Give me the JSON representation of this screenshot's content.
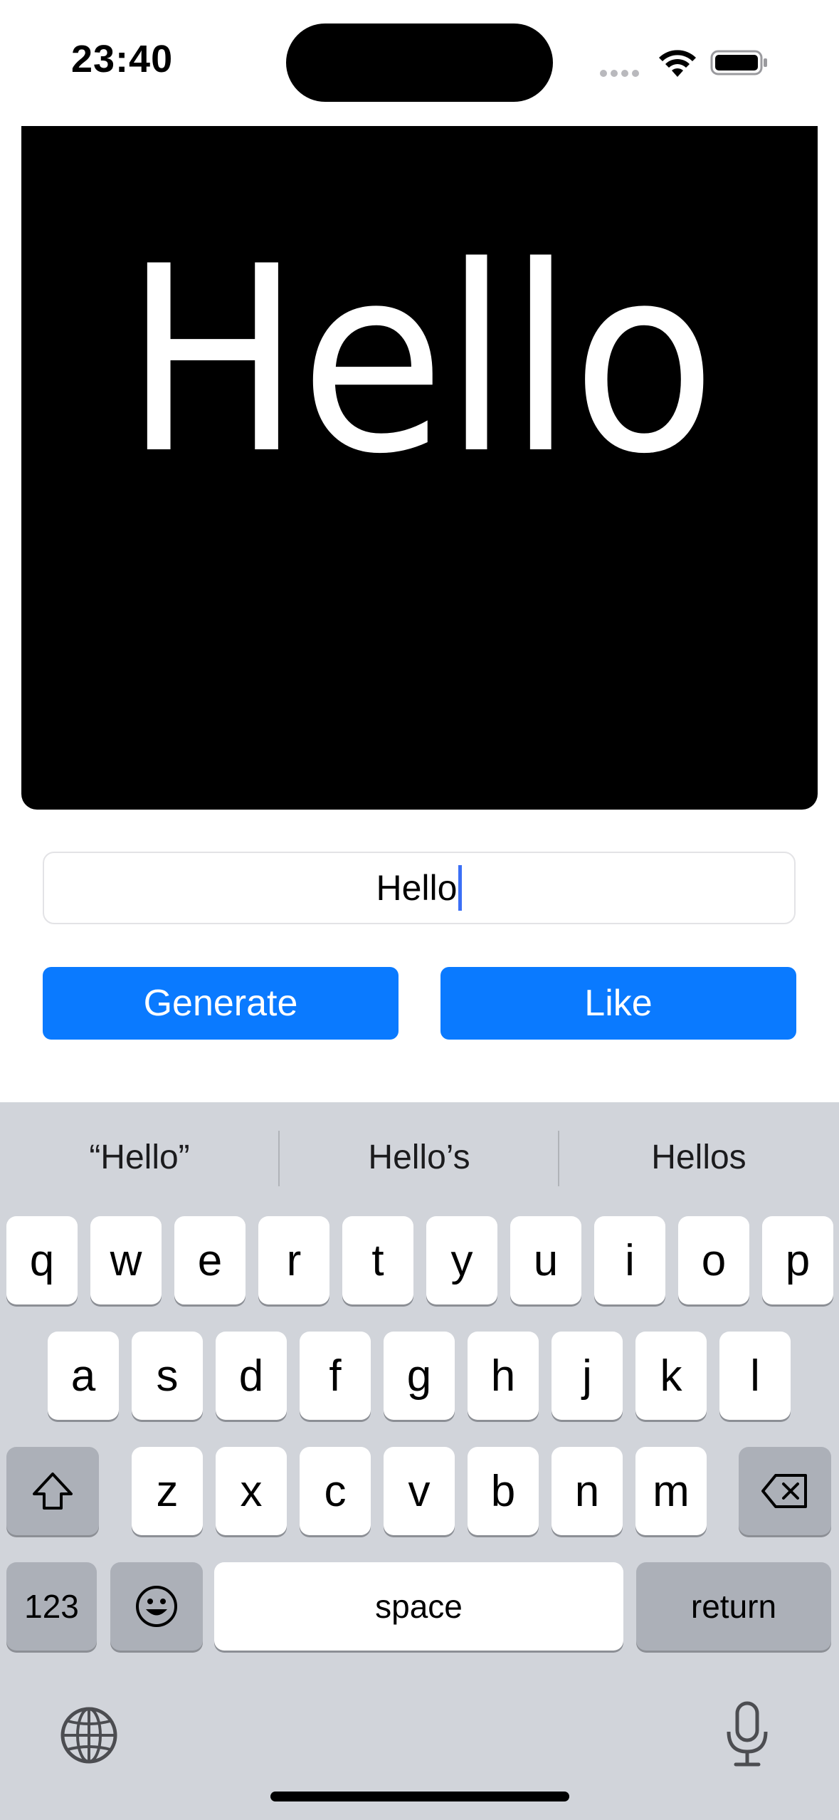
{
  "status_bar": {
    "time": "23:40"
  },
  "preview": {
    "text": "Hello"
  },
  "text_field": {
    "value": "Hello"
  },
  "buttons": {
    "generate": "Generate",
    "like": "Like"
  },
  "keyboard": {
    "suggestions": [
      "“Hello”",
      "Hello’s",
      "Hellos"
    ],
    "row1": [
      "q",
      "w",
      "e",
      "r",
      "t",
      "y",
      "u",
      "i",
      "o",
      "p"
    ],
    "row2": [
      "a",
      "s",
      "d",
      "f",
      "g",
      "h",
      "j",
      "k",
      "l"
    ],
    "row3": [
      "z",
      "x",
      "c",
      "v",
      "b",
      "n",
      "m"
    ],
    "numbers_label": "123",
    "space_label": "space",
    "return_label": "return",
    "icons": {
      "shift": "shift-icon",
      "delete": "delete-icon",
      "emoji": "emoji-icon",
      "globe": "globe-icon",
      "mic": "microphone-icon"
    }
  },
  "colors": {
    "accent": "#0a7aff",
    "keyboard_bg": "#d1d4da",
    "cursor": "#3b6ff5"
  }
}
